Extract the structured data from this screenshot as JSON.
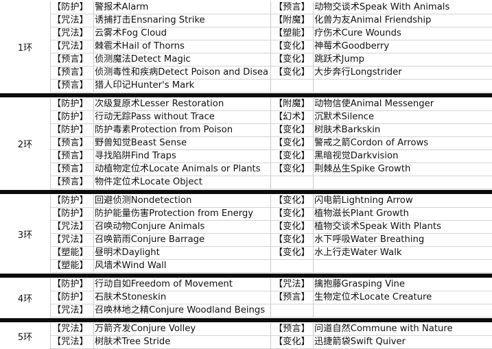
{
  "rings": [
    {
      "label": "1环",
      "rows": [
        {
          "s1": "【防护】",
          "n1": "警报术Alarm",
          "s2": "【预言】",
          "n2": "动物交谈术Speak With Animals"
        },
        {
          "s1": "【咒法】",
          "n1": "诱捕打击Ensnaring Strike",
          "s2": "【附魔】",
          "n2": "化兽为友Animal Friendship"
        },
        {
          "s1": "【咒法】",
          "n1": "云雾术Fog Cloud",
          "s2": "【塑能】",
          "n2": "疗伤术Cure Wounds"
        },
        {
          "s1": "【咒法】",
          "n1": "棘雹术Hail of Thorns",
          "s2": "【变化】",
          "n2": "神莓术Goodberry"
        },
        {
          "s1": "【预言】",
          "n1": "侦测魔法Detect Magic",
          "s2": "【变化】",
          "n2": "跳跃术Jump"
        },
        {
          "s1": "【预言】",
          "n1": "侦测毒性和疾病Detect Poison and Disea",
          "s2": "【变化】",
          "n2": "大步奔行Longstrider"
        },
        {
          "s1": "【预言】",
          "n1": "猎人印记Hunter's Mark",
          "s2": "",
          "n2": ""
        }
      ]
    },
    {
      "label": "2环",
      "rows": [
        {
          "s1": "【防护】",
          "n1": "次级复原术Lesser Restoration",
          "s2": "【附魔】",
          "n2": "动物信使Animal Messenger"
        },
        {
          "s1": "【防护】",
          "n1": "行动无踪Pass without Trace",
          "s2": "【幻术】",
          "n2": "沉默术Silence"
        },
        {
          "s1": "【防护】",
          "n1": "防护毒素Protection from Poison",
          "s2": "【变化】",
          "n2": "树肤术Barkskin"
        },
        {
          "s1": "【预言】",
          "n1": "野兽知觉Beast Sense",
          "s2": "【变化】",
          "n2": "警戒之箭Cordon of Arrows"
        },
        {
          "s1": "【预言】",
          "n1": "寻找陷阱Find Traps",
          "s2": "【变化】",
          "n2": "黑暗视觉Darkvision"
        },
        {
          "s1": "【预言】",
          "n1": "动植物定位术Locate Animals or Plants",
          "s2": "【变化】",
          "n2": "荆棘丛生Spike Growth"
        },
        {
          "s1": "【预言】",
          "n1": "物件定位术Locate Object",
          "s2": "",
          "n2": ""
        }
      ]
    },
    {
      "label": "3环",
      "rows": [
        {
          "s1": "【防护】",
          "n1": "回避侦测Nondetection",
          "s2": "【变化】",
          "n2": "闪电箭Lightning Arrow"
        },
        {
          "s1": "【防护】",
          "n1": "防护能量伤害Protection from Energy",
          "s2": "【变化】",
          "n2": "植物滋长Plant Growth"
        },
        {
          "s1": "【咒法】",
          "n1": "召唤动物Conjure Animals",
          "s2": "【变化】",
          "n2": "植物交谈术Speak With Plants"
        },
        {
          "s1": "【咒法】",
          "n1": "召唤箭雨Conjure Barrage",
          "s2": "【变化】",
          "n2": "水下呼吸Water Breathing"
        },
        {
          "s1": "【塑能】",
          "n1": "昼明术Daylight",
          "s2": "【变化】",
          "n2": "水上行走Water Walk"
        },
        {
          "s1": "【塑能】",
          "n1": "风墙术Wind Wall",
          "s2": "",
          "n2": ""
        }
      ]
    },
    {
      "label": "4环",
      "rows": [
        {
          "s1": "【防护】",
          "n1": "行动自如Freedom of Movement",
          "s2": "【咒法】",
          "n2": "擒抱藤Grasping Vine"
        },
        {
          "s1": "【防护】",
          "n1": "石肤术Stoneskin",
          "s2": "【预言】",
          "n2": "生物定位术Locate Creature"
        },
        {
          "s1": "【咒法】",
          "n1": "召唤林地之精Conjure Woodland Beings",
          "s2": "",
          "n2": ""
        }
      ]
    },
    {
      "label": "5环",
      "rows": [
        {
          "s1": "【咒法】",
          "n1": "万箭齐发Conjure Volley",
          "s2": "【预言】",
          "n2": "问道自然Commune with Nature"
        },
        {
          "s1": "【咒法】",
          "n1": "树肤术Tree Stride",
          "s2": "【变化】",
          "n2": "迅捷箭袋Swift Quiver"
        }
      ]
    }
  ]
}
